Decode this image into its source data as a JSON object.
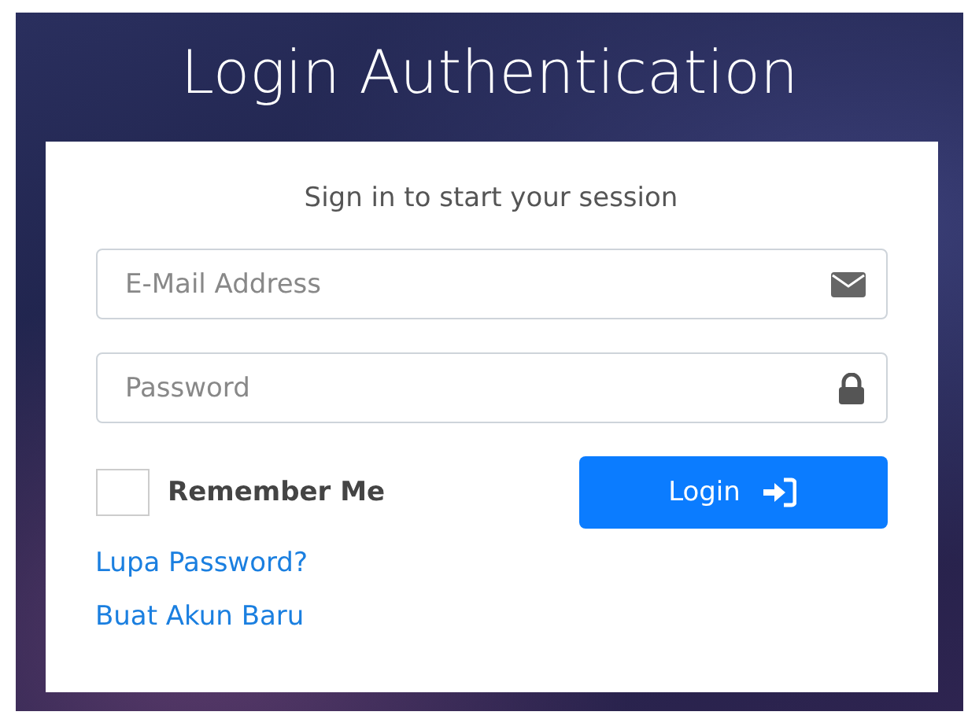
{
  "title": "Login Authentication",
  "card": {
    "subtitle": "Sign in to start your session",
    "fields": [
      {
        "kind": "email",
        "placeholder": "E-Mail Address"
      },
      {
        "kind": "password",
        "placeholder": "Password"
      }
    ],
    "remember": {
      "label": "Remember Me",
      "checked": false
    },
    "login_button": {
      "label": "Login"
    },
    "links": [
      "Lupa Password?",
      "Buat Akun Baru"
    ]
  }
}
